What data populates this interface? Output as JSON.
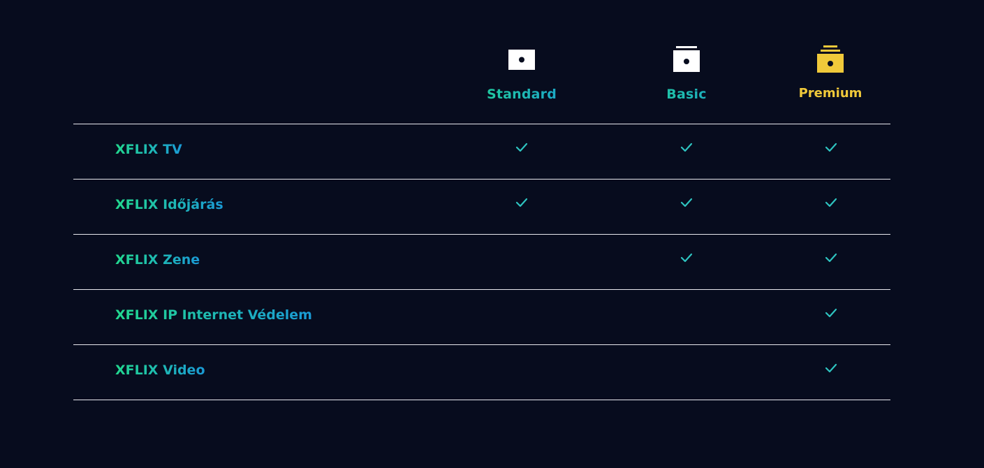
{
  "plans": [
    {
      "name": "Standard",
      "icon": "standard-plan-icon",
      "color": "gradient"
    },
    {
      "name": "Basic",
      "icon": "basic-plan-icon",
      "color": "gradient"
    },
    {
      "name": "Premium",
      "icon": "premium-plan-icon",
      "color": "#f0c93a"
    }
  ],
  "features": [
    {
      "name": "XFLIX TV",
      "included": [
        true,
        true,
        true
      ]
    },
    {
      "name": "XFLIX Időjárás",
      "included": [
        true,
        true,
        true
      ]
    },
    {
      "name": "XFLIX Zene",
      "included": [
        false,
        true,
        true
      ]
    },
    {
      "name": "XFLIX IP Internet Védelem",
      "included": [
        false,
        false,
        true
      ]
    },
    {
      "name": "XFLIX Video",
      "included": [
        false,
        false,
        true
      ]
    }
  ],
  "colors": {
    "background": "#070c1e",
    "gradient_start": "#22d88f",
    "gradient_end": "#1a9ad6",
    "premium": "#f0c93a",
    "check": "#2ec4c0",
    "divider": "#e8e8ee"
  }
}
